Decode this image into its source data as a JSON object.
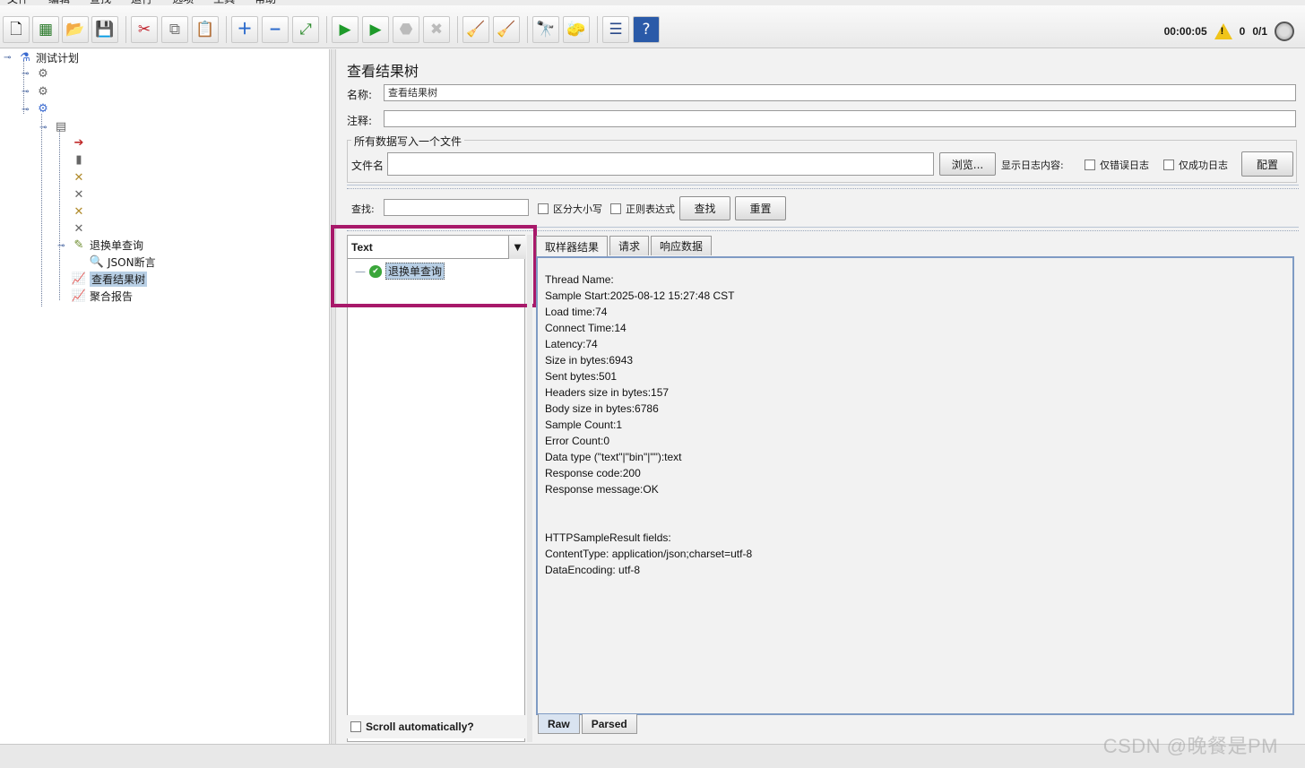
{
  "menu": [
    "文件",
    "编辑",
    "查找",
    "运行",
    "选项",
    "工具",
    "帮助"
  ],
  "toolbar": {
    "icons": [
      "new-file-icon",
      "templates-icon",
      "open-icon",
      "save-icon",
      "cut-icon",
      "copy-icon",
      "paste-icon",
      "expand-icon",
      "collapse-icon",
      "toggle-icon",
      "start-icon",
      "start-no-pause-icon",
      "stop-icon",
      "shutdown-icon",
      "clear-icon",
      "clear-all-icon",
      "search-icon",
      "reset-search-icon",
      "function-helper-icon",
      "help-icon"
    ],
    "timer": "00:00:05",
    "warning_count": "0",
    "thread_count": "0/1"
  },
  "tree": {
    "root": "测试计划",
    "sampler": "退换单查询",
    "assertion": "JSON断言",
    "listener_selected": "查看结果树",
    "listener_report": "聚合报告"
  },
  "panel": {
    "title": "查看结果树",
    "name_label": "名称:",
    "name_value": "查看结果树",
    "comment_label": "注释:",
    "comment_value": "",
    "group_title": "所有数据写入一个文件",
    "filename_label": "文件名",
    "filename_value": "",
    "browse_button": "浏览...",
    "log_label": "显示日志内容:",
    "errors_only": "仅错误日志",
    "success_only": "仅成功日志",
    "config_button": "配置"
  },
  "search": {
    "label": "查找:",
    "value": "",
    "case_sensitive": "区分大小写",
    "regex": "正则表达式",
    "find_button": "查找",
    "reset_button": "重置"
  },
  "results": {
    "renderer": "Text",
    "sample_name": "退换单查询",
    "scroll_auto": "Scroll automatically?",
    "tabs": [
      "取样器结果",
      "请求",
      "响应数据"
    ],
    "bottom_tabs": [
      "Raw",
      "Parsed"
    ],
    "lines": [
      "Thread Name:",
      "Sample Start:2025-08-12 15:27:48 CST",
      "Load time:74",
      "Connect Time:14",
      "Latency:74",
      "Size in bytes:6943",
      "Sent bytes:501",
      "Headers size in bytes:157",
      "Body size in bytes:6786",
      "Sample Count:1",
      "Error Count:0",
      "Data type (\"text\"|\"bin\"|\"\"):text",
      "Response code:200",
      "Response message:OK",
      "",
      "",
      "HTTPSampleResult fields:",
      "ContentType: application/json;charset=utf-8",
      "DataEncoding: utf-8"
    ]
  },
  "watermark": "CSDN @晚餐是PM",
  "colors": {
    "highlight_box": "#a8196a",
    "selected_bg": "#b8cfe5",
    "success_green": "#3aa63a"
  }
}
